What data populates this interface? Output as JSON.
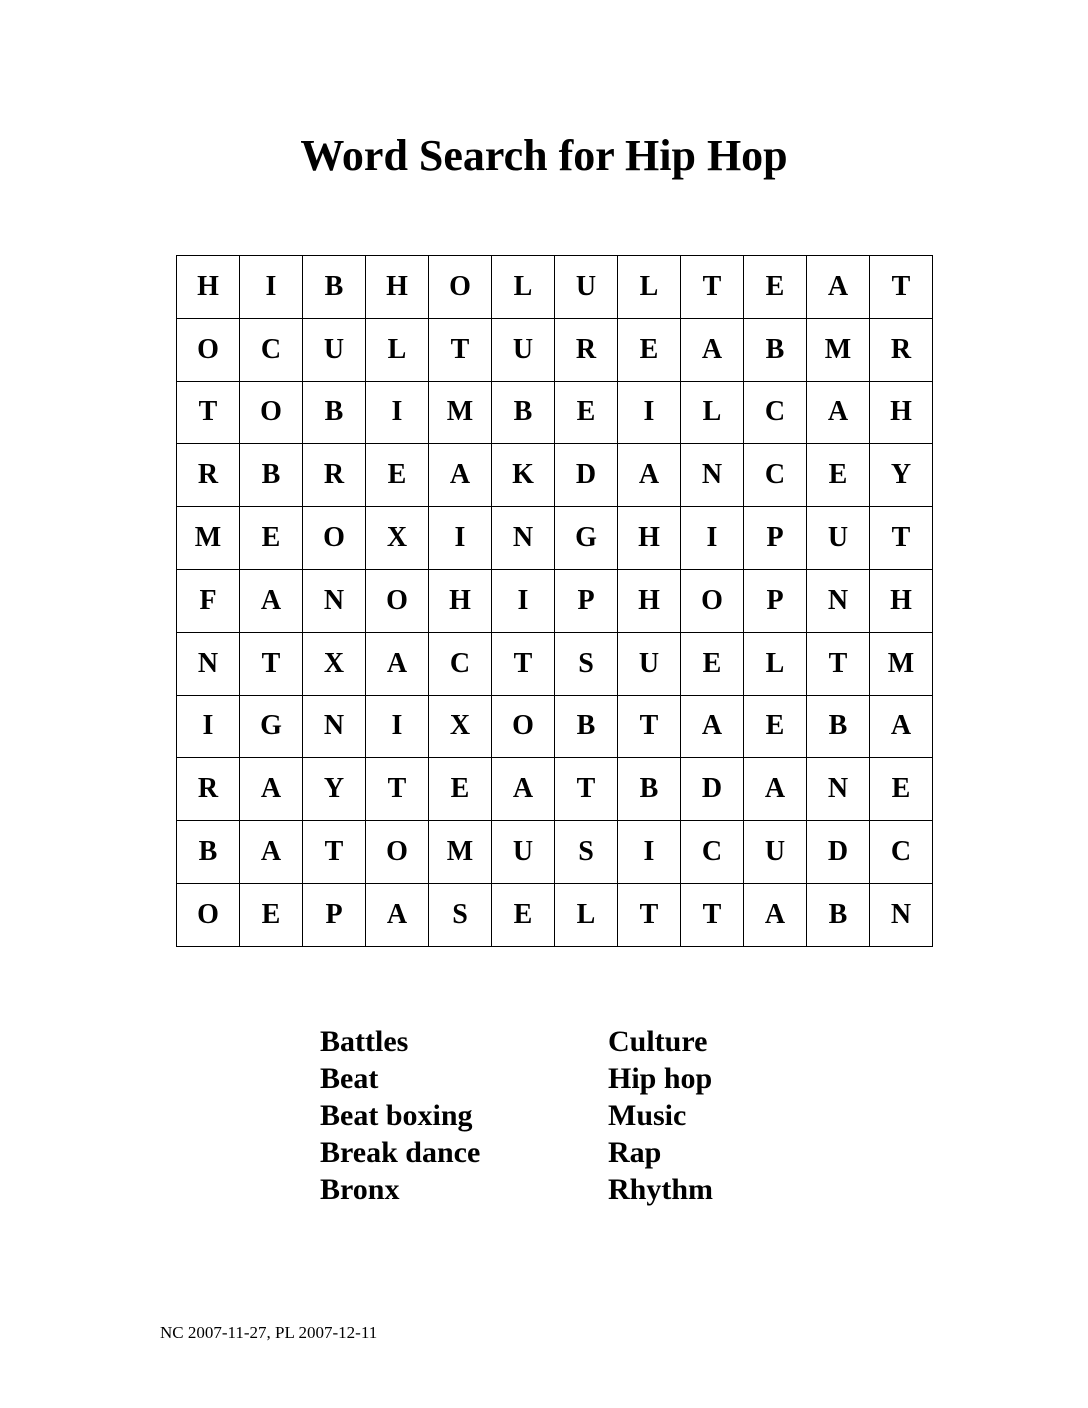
{
  "title": "Word Search for Hip Hop",
  "grid": [
    [
      "H",
      "I",
      "B",
      "H",
      "O",
      "L",
      "U",
      "L",
      "T",
      "E",
      "A",
      "T"
    ],
    [
      "O",
      "C",
      "U",
      "L",
      "T",
      "U",
      "R",
      "E",
      "A",
      "B",
      "M",
      "R"
    ],
    [
      "T",
      "O",
      "B",
      "I",
      "M",
      "B",
      "E",
      "I",
      "L",
      "C",
      "A",
      "H"
    ],
    [
      "R",
      "B",
      "R",
      "E",
      "A",
      "K",
      "D",
      "A",
      "N",
      "C",
      "E",
      "Y"
    ],
    [
      "M",
      "E",
      "O",
      "X",
      "I",
      "N",
      "G",
      "H",
      "I",
      "P",
      "U",
      "T"
    ],
    [
      "F",
      "A",
      "N",
      "O",
      "H",
      "I",
      "P",
      "H",
      "O",
      "P",
      "N",
      "H"
    ],
    [
      "N",
      "T",
      "X",
      "A",
      "C",
      "T",
      "S",
      "U",
      "E",
      "L",
      "T",
      "M"
    ],
    [
      "I",
      "G",
      "N",
      "I",
      "X",
      "O",
      "B",
      "T",
      "A",
      "E",
      "B",
      "A"
    ],
    [
      "R",
      "A",
      "Y",
      "T",
      "E",
      "A",
      "T",
      "B",
      "D",
      "A",
      "N",
      "E"
    ],
    [
      "B",
      "A",
      "T",
      "O",
      "M",
      "U",
      "S",
      "I",
      "C",
      "U",
      "D",
      "C"
    ],
    [
      "O",
      "E",
      "P",
      "A",
      "S",
      "E",
      "L",
      "T",
      "T",
      "A",
      "B",
      "N"
    ]
  ],
  "word_list": {
    "column_1": [
      "Battles",
      "Beat",
      "Beat boxing",
      "Break dance",
      "Bronx"
    ],
    "column_2": [
      "Culture",
      "Hip hop",
      "Music",
      "Rap",
      "Rhythm"
    ]
  },
  "footer": "NC 2007-11-27, PL 2007-12-11"
}
